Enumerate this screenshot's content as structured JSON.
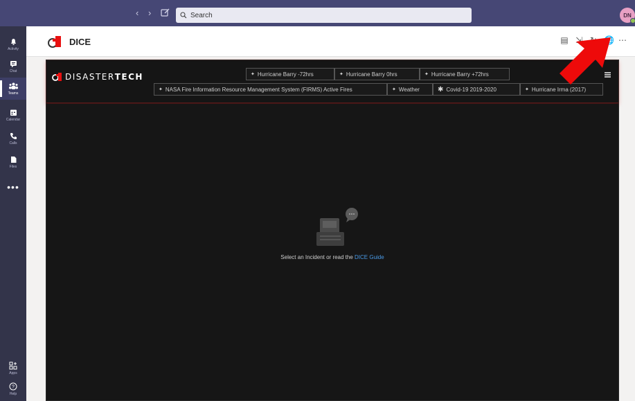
{
  "topbar": {
    "search_placeholder": "Search",
    "user_initials": "DN"
  },
  "rail": {
    "items": [
      {
        "label": "Activity",
        "icon": "bell-icon"
      },
      {
        "label": "Chat",
        "icon": "chat-icon"
      },
      {
        "label": "Teams",
        "icon": "teams-icon",
        "active": true
      },
      {
        "label": "Calendar",
        "icon": "calendar-icon"
      },
      {
        "label": "Calls",
        "icon": "phone-icon"
      },
      {
        "label": "Files",
        "icon": "file-icon"
      }
    ],
    "more": "•••",
    "bottom": [
      {
        "label": "Apps",
        "icon": "apps-icon"
      },
      {
        "label": "Help",
        "icon": "help-icon"
      }
    ]
  },
  "app": {
    "title": "DICE"
  },
  "dice": {
    "brand_light": "DISASTER",
    "brand_bold": "TECH",
    "tabs_row1": [
      {
        "label": "Hurricane Barry -72hrs",
        "icon": "storm-icon"
      },
      {
        "label": "Hurricane Barry 0hrs",
        "icon": "storm-icon"
      },
      {
        "label": "Hurricane Barry +72hrs",
        "icon": "storm-icon"
      }
    ],
    "tabs_row2": [
      {
        "label": "NASA Fire Information Resource Management System (FIRMS) Active Fires",
        "icon": "storm-icon"
      },
      {
        "label": "Weather",
        "icon": "storm-icon"
      },
      {
        "label": "Covid-19 2019-2020",
        "icon": "virus-icon"
      },
      {
        "label": "Hurricane Irma (2017)",
        "icon": "storm-icon"
      }
    ],
    "message_prefix": "Select an Incident or read the ",
    "message_link": "DICE Guide"
  },
  "colors": {
    "teams_purple": "#464775",
    "rail": "#33344a",
    "accent_red": "#e81010",
    "link_blue": "#4a9be8"
  }
}
